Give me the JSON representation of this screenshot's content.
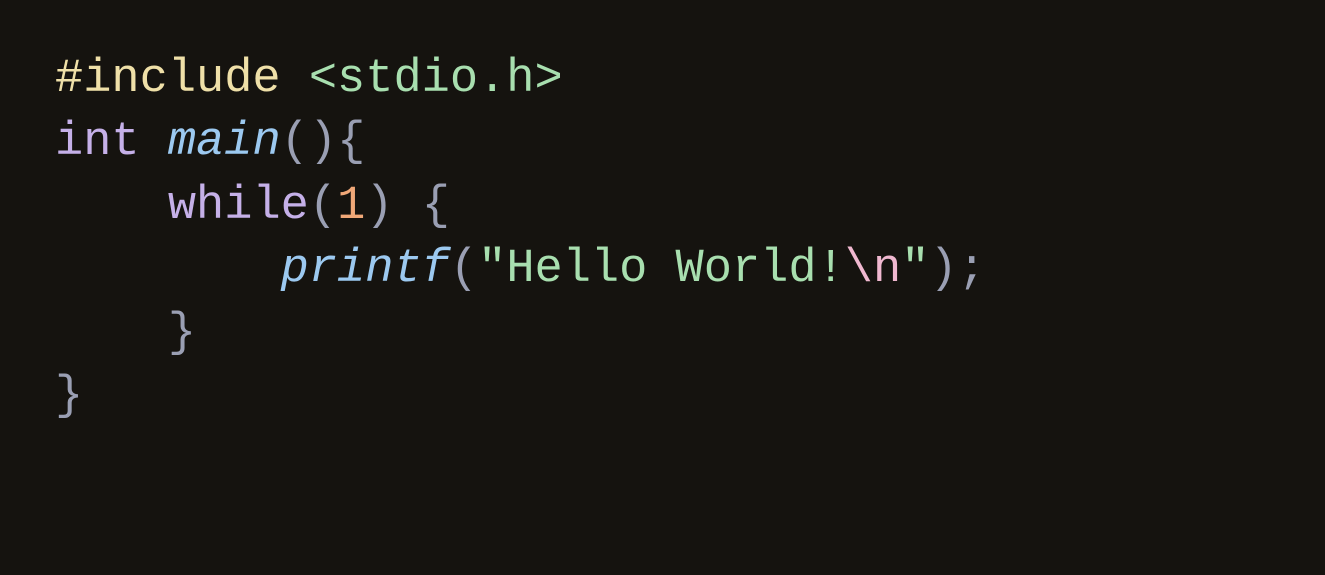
{
  "code": {
    "line1": {
      "directive": "#include ",
      "header": "<stdio.h>"
    },
    "line2": {
      "type": "int ",
      "funcname": "main",
      "parens": "()",
      "brace_open": "{"
    },
    "line3": {
      "indent": "    ",
      "keyword": "while",
      "paren_open": "(",
      "condition": "1",
      "paren_close": ") ",
      "brace_open": "{"
    },
    "line4": {
      "indent": "        ",
      "funcname": "printf",
      "paren_open": "(",
      "quote_open": "\"",
      "string_content": "Hello World!",
      "escape": "\\n",
      "quote_close": "\"",
      "paren_close": ")",
      "semicolon": ";"
    },
    "line5": {
      "indent": "    ",
      "brace_close": "}"
    },
    "line6": {
      "brace_close": "}"
    }
  }
}
